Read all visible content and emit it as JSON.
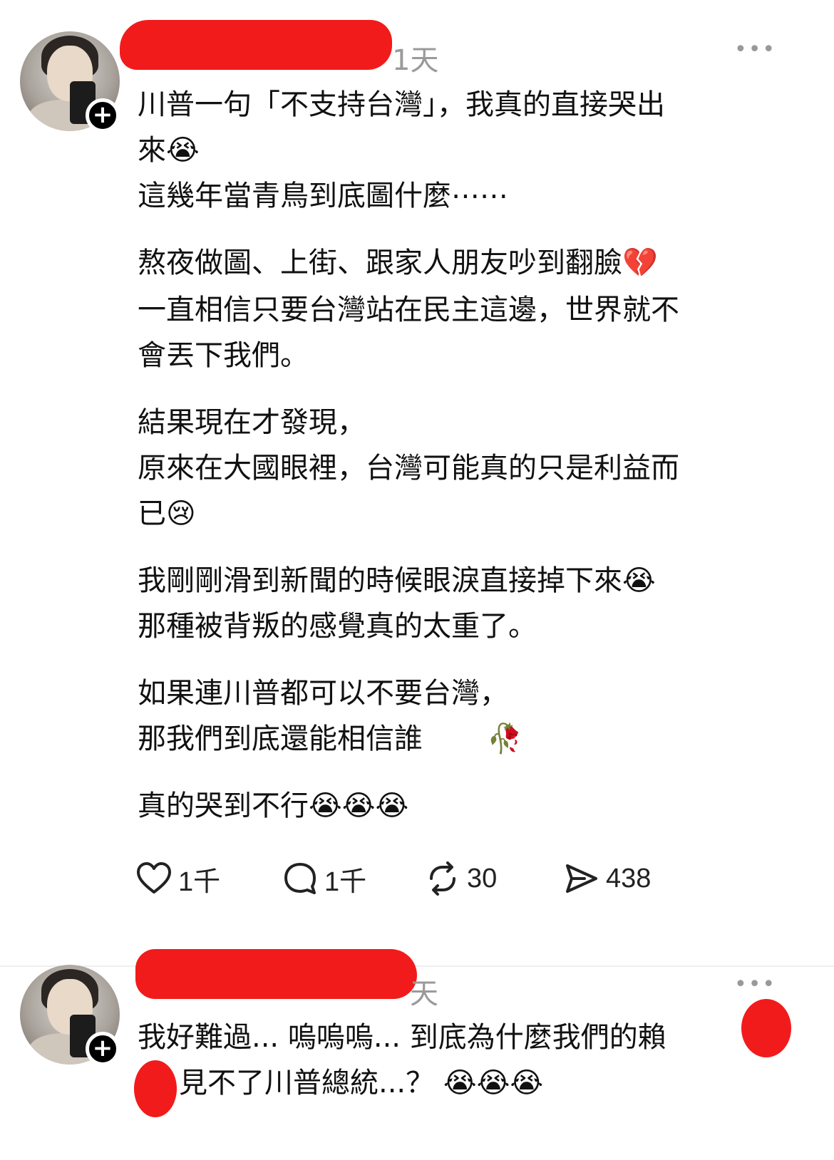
{
  "post1": {
    "time": "1天",
    "more_icon": "more-horizontal-icon",
    "lines": [
      "川普一句「不支持台灣」，我真的直接哭出",
      "來😭",
      "這幾年當青鳥到底圖什麼⋯⋯",
      "熬夜做圖、上街、跟家人朋友吵到翻臉💔",
      "一直相信只要台灣站在民主這邊，世界就不",
      "會丟下我們。",
      "結果現在才發現，",
      "原來在大國眼裡，台灣可能真的只是利益而",
      "已😢",
      "我剛剛滑到新聞的時候眼淚直接掉下來😭",
      "那種被背叛的感覺真的太重了。",
      "如果連川普都可以不要台灣，",
      "那我們到底還能相信誰",
      "🥀",
      "真的哭到不行😭😭😭"
    ],
    "actions": {
      "like_count": "1千",
      "comment_count": "1千",
      "repost_count": "30",
      "share_count": "438"
    }
  },
  "post2": {
    "time": "天",
    "lines": [
      "我好難過... 嗚嗚嗚... 到底為什麼我們的賴",
      "見不了川普總統...？ 😭😭😭"
    ]
  },
  "colors": {
    "redaction": "#f21b1b",
    "muted": "#9a9a9a"
  }
}
